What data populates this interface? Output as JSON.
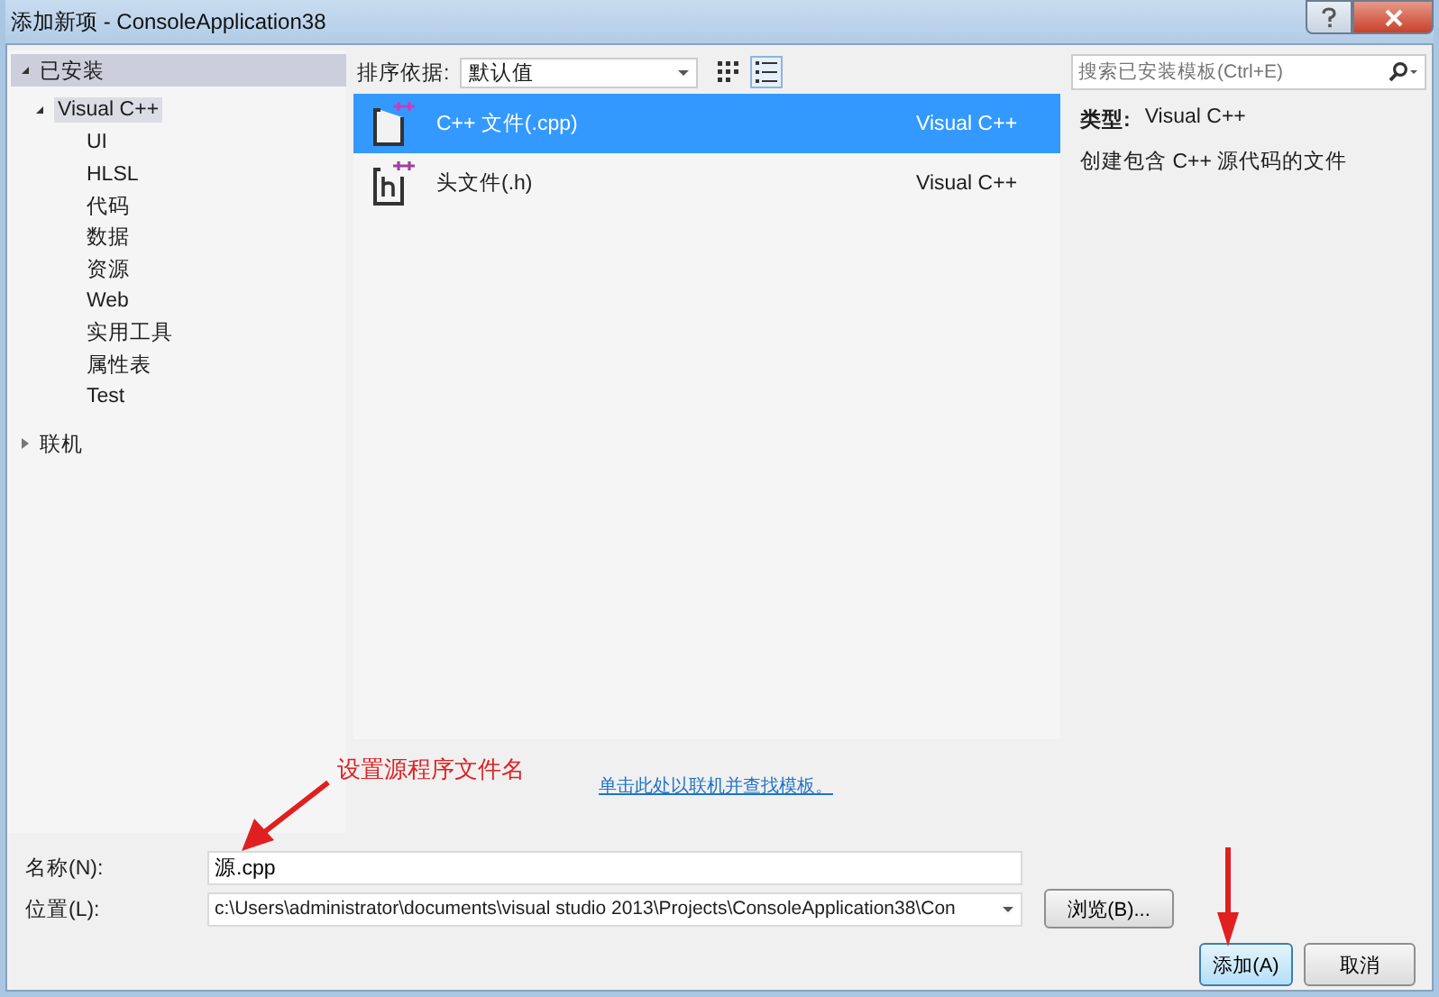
{
  "window": {
    "title": "添加新项 - ConsoleApplication38"
  },
  "sidebar": {
    "sections": [
      {
        "label": "已安装",
        "expanded": true,
        "header": true,
        "children": [
          {
            "label": "Visual C++",
            "expanded": true,
            "selected": true,
            "children": [
              {
                "label": "UI",
                "selected": false
              },
              {
                "label": "HLSL",
                "selected": false
              },
              {
                "label": "代码",
                "selected": false
              },
              {
                "label": "数据",
                "selected": false
              },
              {
                "label": "资源",
                "selected": false
              },
              {
                "label": "Web",
                "selected": false
              },
              {
                "label": "实用工具",
                "selected": false
              },
              {
                "label": "属性表",
                "selected": false
              },
              {
                "label": "Test",
                "selected": false
              }
            ]
          }
        ]
      },
      {
        "label": "联机",
        "expanded": false,
        "header": false
      }
    ]
  },
  "toolbar": {
    "sort_label": "排序依据:",
    "sort_value": "默认值",
    "views": [
      {
        "kind": "grid",
        "selected": false
      },
      {
        "kind": "list",
        "selected": true
      }
    ]
  },
  "templates": [
    {
      "name": "C++ 文件(.cpp)",
      "type": "Visual C++",
      "kind": "source",
      "selected": true
    },
    {
      "name": "头文件(.h)",
      "type": "Visual C++",
      "kind": "header",
      "selected": false
    }
  ],
  "online_link": "单击此处以联机并查找模板。",
  "search": {
    "placeholder": "搜索已安装模板(Ctrl+E)"
  },
  "details": {
    "type_label": "类型:",
    "type_value": "Visual C++",
    "description": "创建包含 C++ 源代码的文件"
  },
  "form": {
    "name_label": "名称(N):",
    "name_value": "源.cpp",
    "location_label": "位置(L):",
    "location_value": "c:\\Users\\administrator\\documents\\visual studio 2013\\Projects\\ConsoleApplication38\\Con",
    "browse": "浏览(B)..."
  },
  "buttons": [
    {
      "label": "添加(A)",
      "kind": "default"
    },
    {
      "label": "取消",
      "kind": "normal"
    }
  ],
  "annotations": [
    {
      "text": "设置源程序文件名"
    }
  ]
}
